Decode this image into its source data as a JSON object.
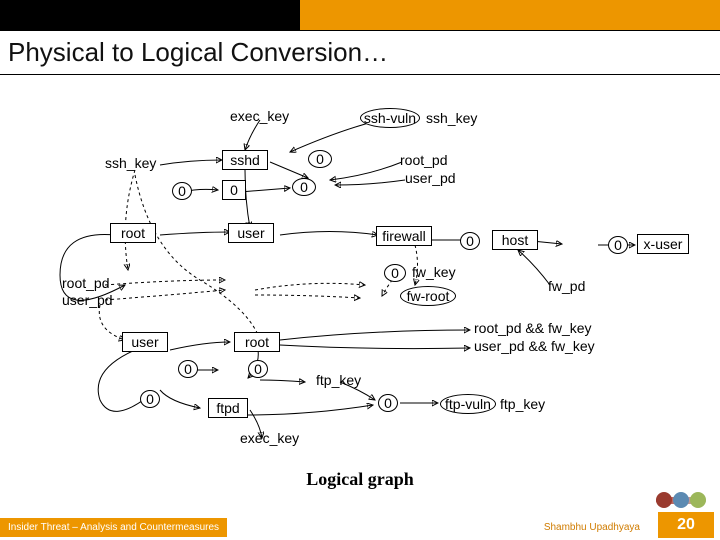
{
  "title": "Physical to Logical Conversion…",
  "caption": "Logical graph",
  "footer": {
    "title": "Insider Threat – Analysis and Countermeasures",
    "author": "Shambhu Upadhyaya",
    "page": "20"
  },
  "nodes": {
    "exec_key_top": "exec_key",
    "ssh_vuln": "ssh-vuln",
    "ssh_key_right": "ssh_key",
    "ssh_key_left": "ssh_key",
    "sshd": "sshd",
    "root_pd_right": "root_pd",
    "user_pd_right": "user_pd",
    "root_left": "root",
    "user_mid": "user",
    "firewall": "firewall",
    "host": "host",
    "x_user": "x-user",
    "root_pd_left": "root_pd",
    "user_pd_left": "user_pd",
    "fw_key": "fw_key",
    "fw_root": "fw-root",
    "fw_pd": "fw_pd",
    "user_bottom": "user",
    "root_bottom": "root",
    "root_pd_fw": "root_pd && fw_key",
    "user_pd_fw": "user_pd && fw_key",
    "ftpd": "ftpd",
    "ftp_key": "ftp_key",
    "ftp_vuln": "ftp-vuln",
    "ftp_key_right": "ftp_key",
    "exec_key_bottom": "exec_key"
  },
  "zeros": {
    "z": "0"
  }
}
